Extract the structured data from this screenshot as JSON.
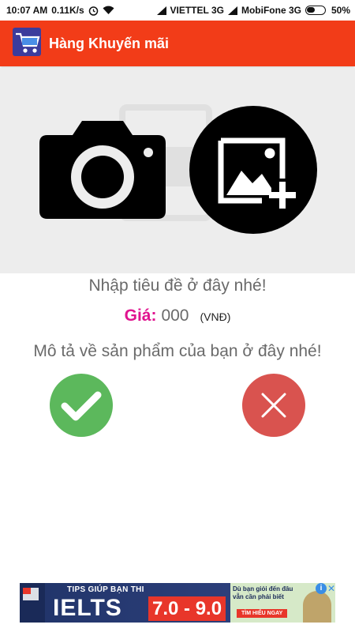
{
  "status_bar": {
    "time": "10:07 AM",
    "speed": "0.11K/s",
    "carrier1": "VIETTEL 3G",
    "carrier2": "MobiFone 3G",
    "battery": "50%"
  },
  "app_bar": {
    "title": "Hàng Khuyến mãi",
    "icon": "shopping-cart-icon",
    "color": "#f23c18"
  },
  "photo_picker": {
    "camera_icon": "camera-icon",
    "gallery_icon": "add-photo-icon"
  },
  "form": {
    "title_placeholder": "Nhập tiêu đề ở đây nhé!",
    "price_label": "Giá:",
    "price_value": "000",
    "price_unit": "(VNĐ)",
    "description_placeholder": "Mô tả về sản phẩm của bạn ở đây nhé!"
  },
  "actions": {
    "confirm_icon": "checkmark-icon",
    "confirm_color": "#5cb85c",
    "cancel_icon": "close-icon",
    "cancel_color": "#d9534f"
  },
  "ad": {
    "headline": "TIPS GIÚP BẠN THI",
    "big_text": "IELTS",
    "score": "7.0 - 9.0",
    "side_text": "Dù bạn giỏi đến đâu vẫn cần phải biết",
    "cta": "TÌM HIỂU NGAY",
    "info_icon": "info-icon",
    "close_icon": "close-icon"
  }
}
